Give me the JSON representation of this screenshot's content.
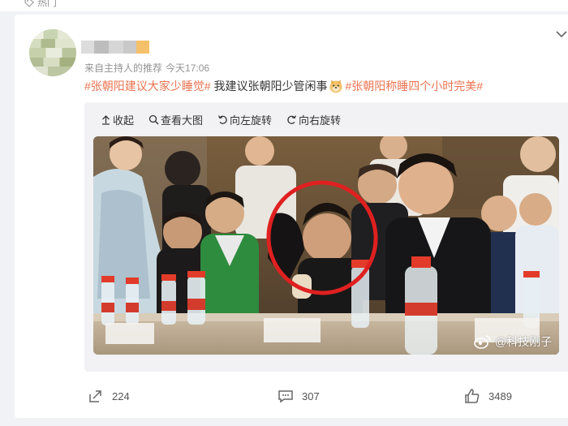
{
  "top_tag": {
    "label": "热门",
    "icon": "tag-icon"
  },
  "post": {
    "source_label": "来自主持人的推荐",
    "time": "今天17:06",
    "hashtag_1": "#张朝阳建议大家少睡觉#",
    "text_1": " 我建议张朝阳少管闲事",
    "hashtag_2": "#张朝阳称睡四个小时完美#",
    "emoji": "doge-emoji"
  },
  "toolbar": {
    "collapse": "收起",
    "view_large": "查看大图",
    "rotate_left": "向左旋转",
    "rotate_right": "向右旋转"
  },
  "photo": {
    "watermark": "@科技刚子",
    "highlight_color": "#e02020"
  },
  "actions": {
    "repost_count": "224",
    "comment_count": "307",
    "like_count": "3489"
  },
  "colors": {
    "hashtag": "#eb7350",
    "meta": "#939393",
    "page_bg": "#f1f2f5"
  }
}
